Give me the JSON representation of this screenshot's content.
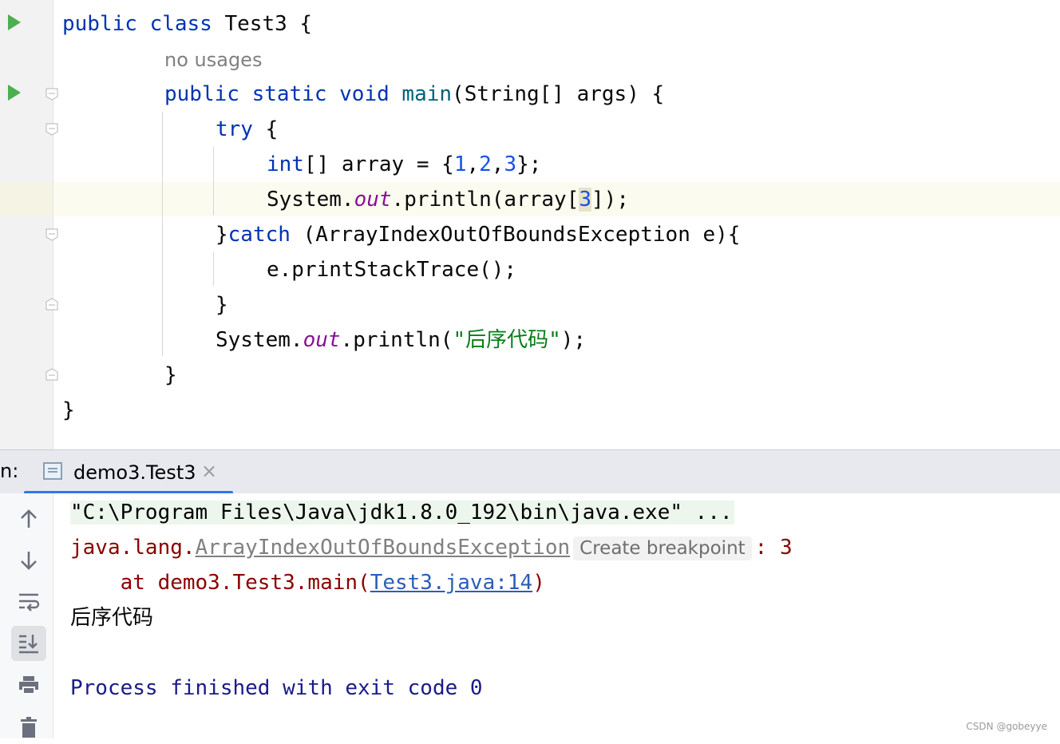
{
  "editor": {
    "line1": {
      "kw": "public class",
      "name": " Test3 {"
    },
    "hint": "no usages",
    "line2": {
      "kw": "public static void",
      "fn": "main",
      "rest": "(String[] args) {"
    },
    "line3": {
      "kw": "try",
      "rest": " {"
    },
    "line4": {
      "kw": "int",
      "a": "[] array = {",
      "n1": "1",
      "n2": "2",
      "n3": "3",
      "b": "};"
    },
    "line5": {
      "a": "System.",
      "out": "out",
      "b": ".println(array[",
      "idx": "3",
      "c": "]);"
    },
    "line6": {
      "a": "}",
      "kw": "catch",
      "b": " (ArrayIndexOutOfBoundsException e){"
    },
    "line7": {
      "a": "e.printStackTrace();"
    },
    "line8": {
      "a": "}"
    },
    "line9": {
      "a": "System.",
      "out": "out",
      "b": ".println(",
      "str": "\"后序代码\"",
      "c": ");"
    },
    "line10": {
      "a": "}"
    },
    "line11": {
      "a": "}"
    }
  },
  "tool": {
    "label": "n:",
    "tab_title": "demo3.Test3",
    "tab_close": "×"
  },
  "console": {
    "cmd": "\"C:\\Program Files\\Java\\jdk1.8.0_192\\bin\\java.exe\" ...",
    "exc_prefix": "java.lang.",
    "exc_name": "ArrayIndexOutOfBoundsException",
    "create_breakpoint": "Create breakpoint",
    "exc_suffix": ": 3",
    "at_prefix": "    at demo3.Test3.main(",
    "at_link": "Test3.java:14",
    "at_suffix": ")",
    "output": "后序代码",
    "exit": "Process finished with exit code 0"
  },
  "toolbar_icons": [
    "up-arrow-icon",
    "down-arrow-icon",
    "soft-wrap-icon",
    "scroll-to-end-icon",
    "print-icon",
    "trash-icon"
  ],
  "watermark": "CSDN @gobeyye",
  "colors": {
    "keyword": "#0033b3",
    "number": "#1750eb",
    "static": "#871094",
    "string": "#067d17",
    "error": "#8b0000",
    "link": "#2c5db7"
  }
}
